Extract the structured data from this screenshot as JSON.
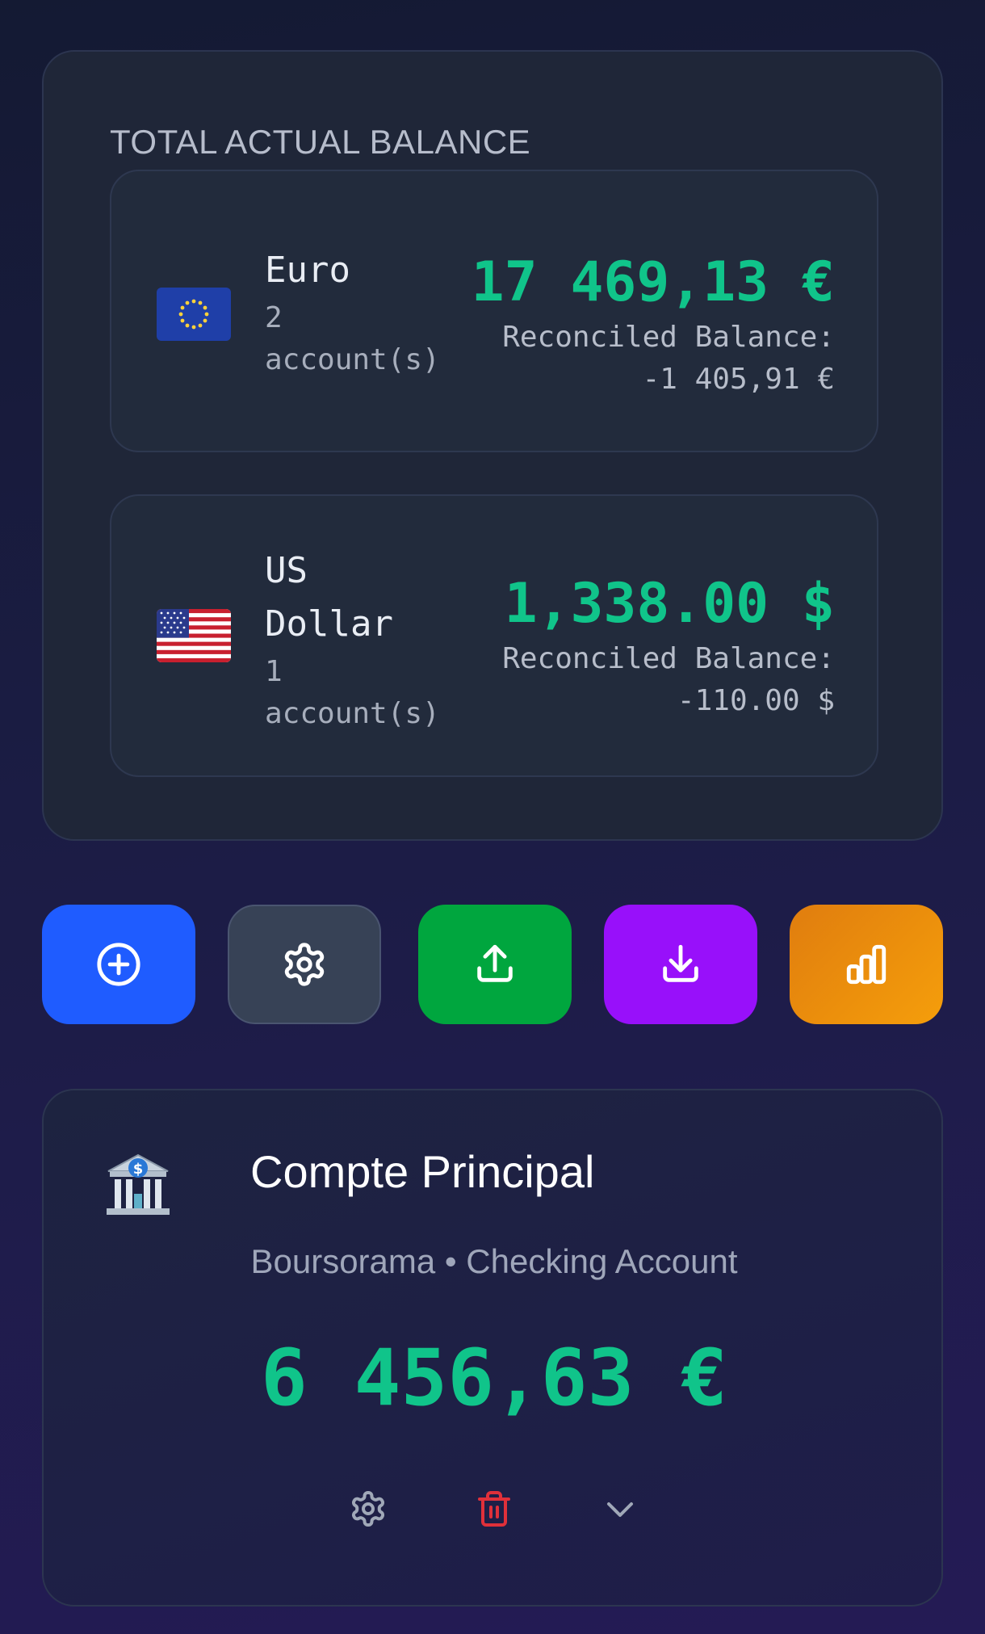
{
  "summary": {
    "title": "TOTAL ACTUAL BALANCE",
    "currencies": [
      {
        "flag": "eu-flag",
        "name_lines": [
          "Euro"
        ],
        "count_lines": [
          "2",
          "account(s)"
        ],
        "amount": "17 469,13 €",
        "reconciled_label": "Reconciled Balance:",
        "reconciled_value": "-1 405,91 €"
      },
      {
        "flag": "us-flag",
        "name_lines": [
          "US",
          "Dollar"
        ],
        "count_lines": [
          "1",
          "account(s)"
        ],
        "amount": "1,338.00 $",
        "reconciled_label": "Reconciled Balance:",
        "reconciled_value": "-110.00 $"
      }
    ]
  },
  "actions": [
    {
      "icon": "plus-circle-icon",
      "color": "#1f5cff"
    },
    {
      "icon": "gear-icon",
      "color": "#374256"
    },
    {
      "icon": "upload-icon",
      "color": "#00a63e"
    },
    {
      "icon": "download-icon",
      "color": "#9810fa"
    },
    {
      "icon": "bar-chart-icon",
      "color": "#e98a0c"
    }
  ],
  "account": {
    "icon": "bank-icon",
    "name": "Compte Principal",
    "subtitle": "Boursorama • Checking Account",
    "balance": "6 456,63 €",
    "action_icons": [
      "gear-icon",
      "trash-icon",
      "chevron-down-icon"
    ]
  },
  "colors": {
    "positive": "#10c48a",
    "danger": "#e0303a"
  }
}
